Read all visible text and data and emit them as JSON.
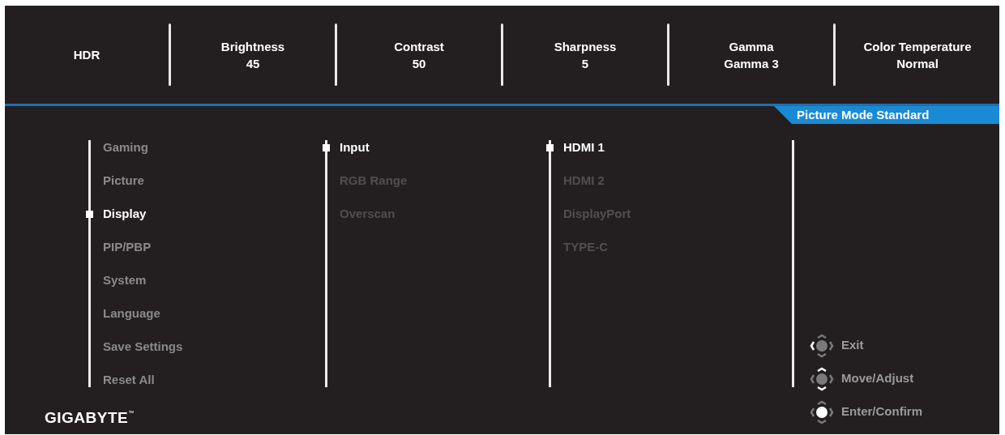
{
  "top_bar": [
    {
      "label": "HDR"
    },
    {
      "label": "Brightness",
      "value": "45"
    },
    {
      "label": "Contrast",
      "value": "50"
    },
    {
      "label": "Sharpness",
      "value": "5"
    },
    {
      "label": "Gamma",
      "value": "Gamma 3"
    },
    {
      "label": "Color Temperature",
      "value": "Normal"
    }
  ],
  "picture_mode": "Picture Mode Standard",
  "main_menu": [
    {
      "label": "Gaming",
      "selected": false
    },
    {
      "label": "Picture",
      "selected": false
    },
    {
      "label": "Display",
      "selected": true
    },
    {
      "label": "PIP/PBP",
      "selected": false
    },
    {
      "label": "System",
      "selected": false
    },
    {
      "label": "Language",
      "selected": false
    },
    {
      "label": "Save Settings",
      "selected": false
    },
    {
      "label": "Reset All",
      "selected": false
    }
  ],
  "submenu": [
    {
      "label": "Input",
      "selected": true,
      "disabled": false
    },
    {
      "label": "RGB Range",
      "selected": false,
      "disabled": true
    },
    {
      "label": "Overscan",
      "selected": false,
      "disabled": true
    }
  ],
  "options": [
    {
      "label": "HDMI 1",
      "selected": true,
      "disabled": false
    },
    {
      "label": "HDMI 2",
      "selected": false,
      "disabled": true
    },
    {
      "label": "DisplayPort",
      "selected": false,
      "disabled": true
    },
    {
      "label": "TYPE-C",
      "selected": false,
      "disabled": true
    }
  ],
  "hints": [
    {
      "kind": "left",
      "label": "Exit"
    },
    {
      "kind": "updown",
      "label": "Move/Adjust"
    },
    {
      "kind": "press",
      "label": "Enter/Confirm"
    }
  ],
  "logo": {
    "text": "GIGABYTE",
    "mark": "™"
  }
}
